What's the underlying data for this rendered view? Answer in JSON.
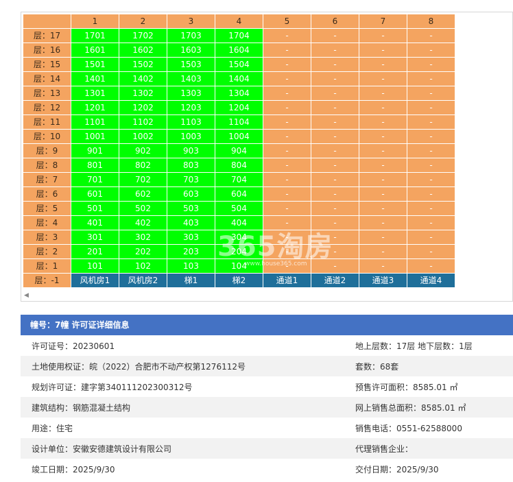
{
  "grid": {
    "columns": [
      "1",
      "2",
      "3",
      "4",
      "5",
      "6",
      "7",
      "8"
    ],
    "floors": [
      {
        "label": "层：17",
        "units": [
          "1701",
          "1702",
          "1703",
          "1704",
          "-",
          "-",
          "-",
          "-"
        ]
      },
      {
        "label": "层：16",
        "units": [
          "1601",
          "1602",
          "1603",
          "1604",
          "-",
          "-",
          "-",
          "-"
        ]
      },
      {
        "label": "层：15",
        "units": [
          "1501",
          "1502",
          "1503",
          "1504",
          "-",
          "-",
          "-",
          "-"
        ]
      },
      {
        "label": "层：14",
        "units": [
          "1401",
          "1402",
          "1403",
          "1404",
          "-",
          "-",
          "-",
          "-"
        ]
      },
      {
        "label": "层：13",
        "units": [
          "1301",
          "1302",
          "1303",
          "1304",
          "-",
          "-",
          "-",
          "-"
        ]
      },
      {
        "label": "层：12",
        "units": [
          "1201",
          "1202",
          "1203",
          "1204",
          "-",
          "-",
          "-",
          "-"
        ]
      },
      {
        "label": "层：11",
        "units": [
          "1101",
          "1102",
          "1103",
          "1104",
          "-",
          "-",
          "-",
          "-"
        ]
      },
      {
        "label": "层：10",
        "units": [
          "1001",
          "1002",
          "1003",
          "1004",
          "-",
          "-",
          "-",
          "-"
        ]
      },
      {
        "label": "层：9",
        "units": [
          "901",
          "902",
          "903",
          "904",
          "-",
          "-",
          "-",
          "-"
        ]
      },
      {
        "label": "层：8",
        "units": [
          "801",
          "802",
          "803",
          "804",
          "-",
          "-",
          "-",
          "-"
        ]
      },
      {
        "label": "层：7",
        "units": [
          "701",
          "702",
          "703",
          "704",
          "-",
          "-",
          "-",
          "-"
        ]
      },
      {
        "label": "层：6",
        "units": [
          "601",
          "602",
          "603",
          "604",
          "-",
          "-",
          "-",
          "-"
        ]
      },
      {
        "label": "层：5",
        "units": [
          "501",
          "502",
          "503",
          "504",
          "-",
          "-",
          "-",
          "-"
        ]
      },
      {
        "label": "层：4",
        "units": [
          "401",
          "402",
          "403",
          "404",
          "-",
          "-",
          "-",
          "-"
        ]
      },
      {
        "label": "层：3",
        "units": [
          "301",
          "302",
          "303",
          "304",
          "-",
          "-",
          "-",
          "-"
        ]
      },
      {
        "label": "层：2",
        "units": [
          "201",
          "202",
          "203",
          "204",
          "-",
          "-",
          "-",
          "-"
        ]
      },
      {
        "label": "层：1",
        "units": [
          "101",
          "102",
          "103",
          "104",
          "-",
          "-",
          "-",
          "-"
        ]
      }
    ],
    "basement": {
      "label": "层：-1",
      "units": [
        "风机房1",
        "风机房2",
        "梯1",
        "梯2",
        "通道1",
        "通道2",
        "通道3",
        "通道4"
      ]
    },
    "colors": {
      "header": "#f4a460",
      "unit_available": "#00ff00",
      "empty": "#f4a460",
      "basement": "#1f6f9a"
    }
  },
  "watermark": {
    "text": "365淘房",
    "subtext": "www.house365.com"
  },
  "scrollbar": {
    "left_arrow_icon": "left-arrow-icon"
  },
  "permit": {
    "title": "幢号：7幢 许可证详细信息",
    "rows": [
      {
        "left": "许可证号：20230601",
        "right": "地上层数：17层  地下层数：1层"
      },
      {
        "left": "土地使用权证：皖（2022）合肥市不动产权第1276112号",
        "right": "套数：68套"
      },
      {
        "left": "规划许可证：建字第340111202300312号",
        "right": "预售许可面积：8585.01 ㎡"
      },
      {
        "left": "建筑结构：钢筋混凝土结构",
        "right": "网上销售总面积：8585.01 ㎡"
      },
      {
        "left": "用途：住宅",
        "right": "销售电话：0551-62588000"
      },
      {
        "left": "设计单位：安徽安德建筑设计有限公司",
        "right": "代理销售企业："
      },
      {
        "left": "竣工日期：2025/9/30",
        "right": "交付日期：2025/9/30"
      }
    ],
    "colors": {
      "header_bg": "#4472c4",
      "alt_row_bg": "#f2f2f2"
    }
  }
}
